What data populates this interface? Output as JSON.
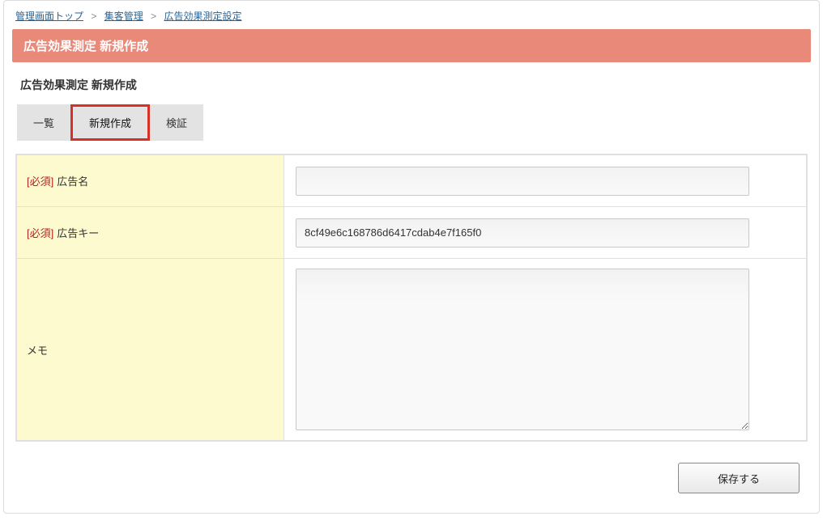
{
  "breadcrumb": {
    "items": [
      {
        "label": "管理画面トップ"
      },
      {
        "label": "集客管理"
      },
      {
        "label": "広告効果測定設定"
      }
    ],
    "separator": ">"
  },
  "banner": {
    "title": "広告効果測定 新規作成"
  },
  "subtitle": "広告効果測定 新規作成",
  "tabs": {
    "list": {
      "label": "一覧"
    },
    "create": {
      "label": "新規作成"
    },
    "verify": {
      "label": "検証"
    }
  },
  "form": {
    "required_tag": "[必須]",
    "ad_name": {
      "label": "広告名",
      "value": ""
    },
    "ad_key": {
      "label": "広告キー",
      "value": "8cf49e6c168786d6417cdab4e7f165f0"
    },
    "memo": {
      "label": "メモ",
      "value": ""
    }
  },
  "actions": {
    "save": "保存する"
  }
}
